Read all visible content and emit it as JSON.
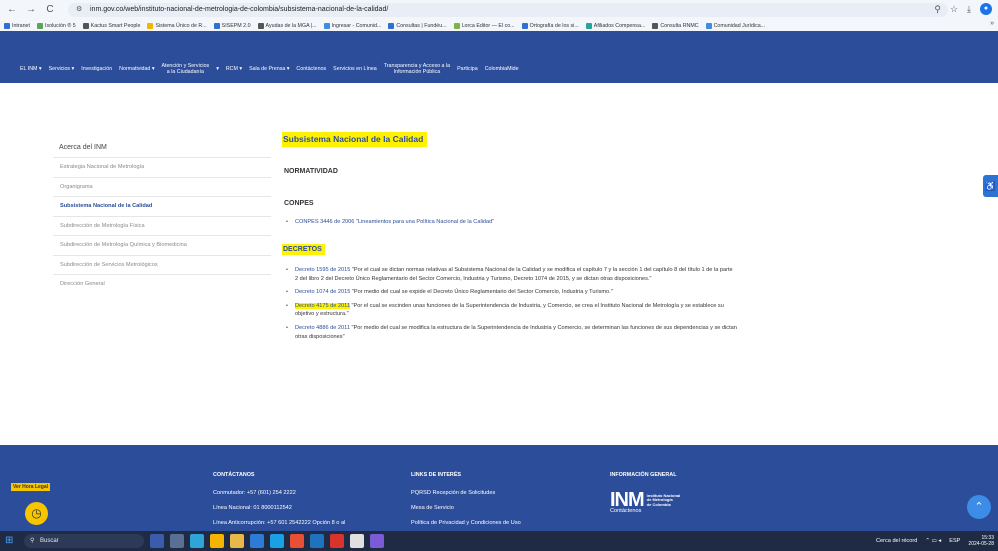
{
  "browser": {
    "back": "←",
    "forward": "→",
    "reload": "C",
    "url": "inm.gov.co/web/instituto-nacional-de-metrologia-de-colombia/subsistema-nacional-de-la-calidad/",
    "bookmarks": [
      {
        "label": "Intranet",
        "color": "#2f6fd6"
      },
      {
        "label": "Isolución ® 5",
        "color": "#58a55c"
      },
      {
        "label": "Kactus Smart People",
        "color": "#555555"
      },
      {
        "label": "Sistema Único de R...",
        "color": "#f4b400"
      },
      {
        "label": "SISEPM 2.0",
        "color": "#2f6fd6"
      },
      {
        "label": "Ayudas de la MGA |...",
        "color": "#555555"
      },
      {
        "label": "Ingresar - Comunid...",
        "color": "#3c8ce8"
      },
      {
        "label": "Consultas | Fundéu...",
        "color": "#2f6fd6"
      },
      {
        "label": "Lorca Editor — El co...",
        "color": "#7cb342"
      },
      {
        "label": "Ortografía de los si...",
        "color": "#2f6fd6"
      },
      {
        "label": "Afiliados Compensa...",
        "color": "#26a69a"
      },
      {
        "label": "Consulta RNMC",
        "color": "#555555"
      },
      {
        "label": "Comunidad Jurídica...",
        "color": "#3c8ce8"
      }
    ],
    "more": "»"
  },
  "nav": {
    "items": [
      "EL INM ▾",
      "Servicios ▾",
      "Investigación",
      "Normatividad ▾",
      "Atención y Servicios\na la Ciudadanía",
      "▾",
      "RCM ▾",
      "Sala de Prensa ▾",
      "Contáctenos",
      "Servicios en Línea",
      "Transparencia y Acceso a la\nInformación Pública",
      "Participa",
      "ColombiaMide"
    ]
  },
  "sidebar": {
    "title": "Acerca del INM",
    "items": [
      {
        "label": "Estrategia Nacional de Metrología",
        "active": false
      },
      {
        "label": "Organigrama",
        "active": false
      },
      {
        "label": "Subsistema Nacional de la Calidad",
        "active": true
      },
      {
        "label": "Subdirección de Metrología Física",
        "active": false
      },
      {
        "label": "Subdirección de Metrología Química y Biomedicina",
        "active": false
      },
      {
        "label": "Subdirección de Servicios Metrológicos",
        "active": false
      },
      {
        "label": "Dirección General",
        "active": false
      }
    ]
  },
  "content": {
    "title": "Subsistema Nacional de la Calidad",
    "normatividad": "NORMATIVIDAD",
    "conpes_title": "CONPES",
    "conpes_item": "CONPES 3446 de 2006 \"Lineamientos para una Política Nacional de la Calidad\"",
    "decretos_title": "DECRETOS",
    "decretos": [
      {
        "link": "Decreto 1595 de 2015",
        "text": " \"Por el cual se dictan normas relativas al Subsistema Nacional de la Calidad y se modifica el capítulo 7 y la sección 1 del capítulo 8 del título 1 de la parte 2 del libro 2 del Decreto Único Reglamentario del Sector Comercio, Industria y Turismo, Decreto 1074 de 2015, y se dictan otras disposiciones.\"",
        "highlight": false
      },
      {
        "link": "Decreto 1074 de 2015",
        "text": " \"Por medio del cual se expide el Decreto Único Reglamentario del Sector Comercio, Industria y Turismo.\"",
        "highlight": false
      },
      {
        "link": "Decreto 4175 de 2011",
        "text": " \"Por el cual se escinden unas funciones de la Superintendencia de Industria, y Comercio, se crea el Instituto Nacional de Metrología y se establece su objetivo y estructura.\"",
        "highlight": true
      },
      {
        "link": "Decreto 4886 de 2011",
        "text": " \"Por medio del cual se modifica la estructura de la Superintendencia de Industria y Comercio, se determinan las funciones de sus dependencias y se dictan otras disposiciones\"",
        "highlight": false
      }
    ]
  },
  "footer": {
    "contact_head": "CONTÁCTANOS",
    "contact_lines": [
      "Conmutador: +57 (601) 254 2222",
      "Línea Nacional: 01 8000112542",
      "Línea Anticorrupción: +57 601 2542222 Opción 8 o al"
    ],
    "links_head": "LINKS DE INTERÉS",
    "links_lines": [
      "PQRSD Recepción de Solicitudes",
      "Mesa de Servicio",
      "Política de Privacidad y Condiciones de Uso"
    ],
    "info_head": "INFORMACIÓN GENERAL",
    "info_lines": [
      "Contáctenos"
    ],
    "logo_big": "INM",
    "logo_small": [
      "Instituto Nacional",
      "de Metrología",
      "de Colombia"
    ],
    "hora_legal": "Ver Hora Legal"
  },
  "taskbar": {
    "search_placeholder": "Buscar",
    "weather": "Cerca del récord",
    "lang": "ESP",
    "time": "15:33",
    "date": "2024-05-28"
  },
  "colors": {
    "brand": "#2c4d9a",
    "highlight": "#fff200",
    "accent": "#f7c600"
  }
}
